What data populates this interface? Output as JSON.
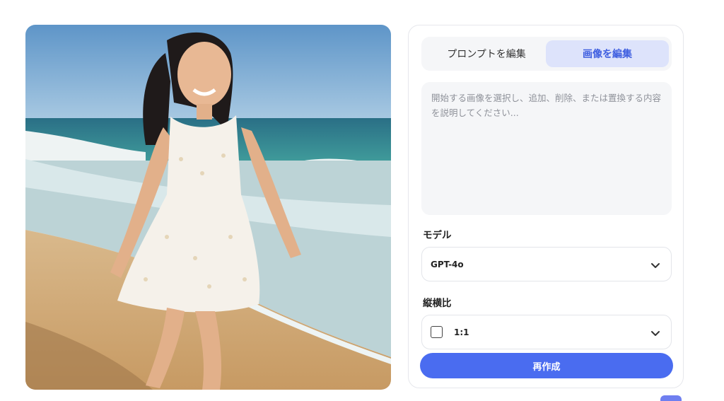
{
  "image": {
    "icon": "photo-preview"
  },
  "tabs": [
    {
      "label": "プロンプトを編集",
      "active": false
    },
    {
      "label": "画像を編集",
      "active": true
    }
  ],
  "prompt": {
    "placeholder": "開始する画像を選択し、追加、削除、または置換する内容を説明してください..."
  },
  "model": {
    "label": "モデル",
    "value": "GPT-4o"
  },
  "aspect": {
    "label": "縦横比",
    "value": "1:1"
  },
  "actions": {
    "regenerate_label": "再作成"
  },
  "colors": {
    "accent": "#4a6cf0",
    "tab_active_bg": "#dde3fb",
    "tab_active_text": "#3f5fe0"
  }
}
